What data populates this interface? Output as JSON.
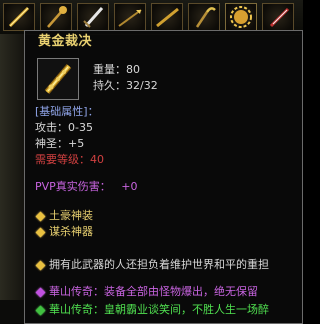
{
  "slots": [
    {
      "icon": "golden-staff-icon"
    },
    {
      "icon": "ornate-staff-icon"
    },
    {
      "icon": "sword-icon"
    },
    {
      "icon": "spear-icon"
    },
    {
      "icon": "golden-pole-icon"
    },
    {
      "icon": "hook-staff-icon"
    },
    {
      "icon": "sun-wheel-icon"
    },
    {
      "icon": "blade-icon"
    }
  ],
  "item": {
    "name": "黄金裁决",
    "icon": "golden-weapon-icon",
    "weight_label": "重量：",
    "weight_value": "80",
    "durability_label": "持久：",
    "durability_value": "32/32"
  },
  "base_attrs": {
    "header": "[基础属性]：",
    "attack": "攻击：0-35",
    "holy": "神圣：+5",
    "required_level": "需要等级：40"
  },
  "pvp": {
    "label": "PVP真实伤害：",
    "value": "+0"
  },
  "tags": [
    {
      "text": "土豪神装"
    },
    {
      "text": "谋杀神器"
    }
  ],
  "lore": "拥有此武器的人还担负着维护世界和平的重担",
  "broadcasts": [
    {
      "text": "華山传奇：装备全部由怪物爆出，绝无保留"
    },
    {
      "text": "華山传奇：皇朝霸业谈笑间，不胜人生一场醉"
    }
  ],
  "colors": {
    "title": "#e8d070",
    "attr_header": "#8fa4e8",
    "required_level": "#d04040",
    "pvp": "#c864e0",
    "tags": "#e8d070",
    "broadcast_1": "#c864e0",
    "broadcast_2": "#50e050"
  }
}
